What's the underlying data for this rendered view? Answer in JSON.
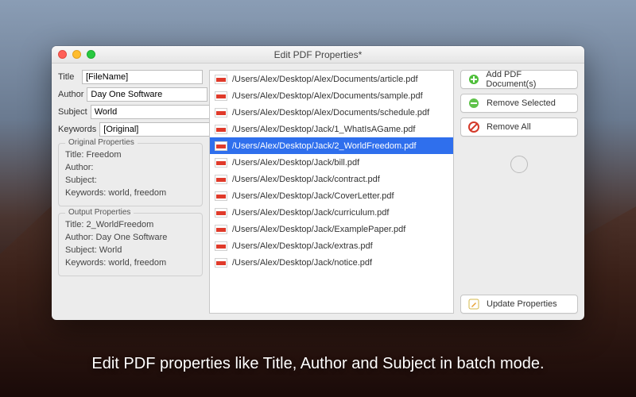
{
  "window": {
    "title": "Edit PDF Properties*"
  },
  "fields": {
    "title": {
      "label": "Title",
      "value": "[FileName]"
    },
    "author": {
      "label": "Author",
      "value": "Day One Software"
    },
    "subject": {
      "label": "Subject",
      "value": "World"
    },
    "keywords": {
      "label": "Keywords",
      "value": "[Original]"
    }
  },
  "original": {
    "legend": "Original Properties",
    "title": "Title: Freedom",
    "author": "Author:",
    "subject": "Subject:",
    "keywords": "Keywords: world, freedom"
  },
  "output": {
    "legend": "Output Properties",
    "title": "Title: 2_WorldFreedom",
    "author": "Author: Day One Software",
    "subject": "Subject: World",
    "keywords": "Keywords: world, freedom"
  },
  "files": [
    {
      "path": "/Users/Alex/Desktop/Alex/Documents/article.pdf",
      "selected": false
    },
    {
      "path": "/Users/Alex/Desktop/Alex/Documents/sample.pdf",
      "selected": false
    },
    {
      "path": "/Users/Alex/Desktop/Alex/Documents/schedule.pdf",
      "selected": false
    },
    {
      "path": "/Users/Alex/Desktop/Jack/1_WhatIsAGame.pdf",
      "selected": false
    },
    {
      "path": "/Users/Alex/Desktop/Jack/2_WorldFreedom.pdf",
      "selected": true
    },
    {
      "path": "/Users/Alex/Desktop/Jack/bill.pdf",
      "selected": false
    },
    {
      "path": "/Users/Alex/Desktop/Jack/contract.pdf",
      "selected": false
    },
    {
      "path": "/Users/Alex/Desktop/Jack/CoverLetter.pdf",
      "selected": false
    },
    {
      "path": "/Users/Alex/Desktop/Jack/curriculum.pdf",
      "selected": false
    },
    {
      "path": "/Users/Alex/Desktop/Jack/ExamplePaper.pdf",
      "selected": false
    },
    {
      "path": "/Users/Alex/Desktop/Jack/extras.pdf",
      "selected": false
    },
    {
      "path": "/Users/Alex/Desktop/Jack/notice.pdf",
      "selected": false
    }
  ],
  "buttons": {
    "add": "Add PDF Document(s)",
    "remove": "Remove Selected",
    "removeAll": "Remove All",
    "update": "Update Properties"
  },
  "caption": "Edit PDF properties like Title, Author and Subject in batch mode."
}
